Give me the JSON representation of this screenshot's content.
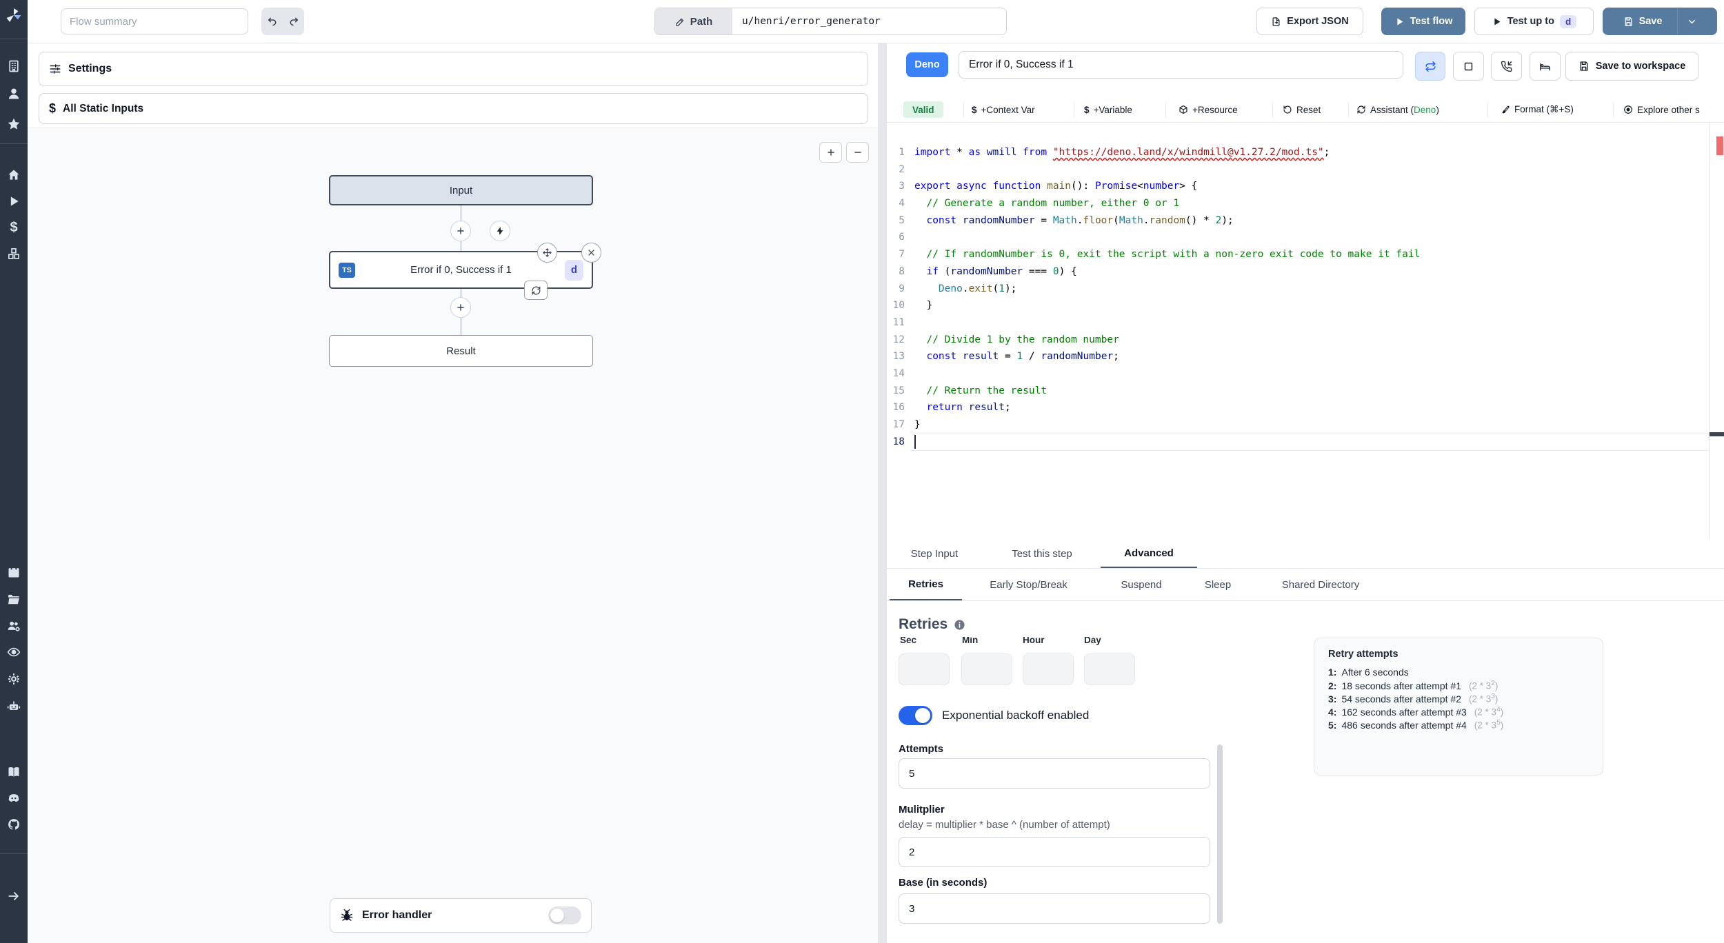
{
  "topbar": {
    "flow_summary_placeholder": "Flow summary",
    "path_label": "Path",
    "path_value": "u/henri/error_generator",
    "export_json_label": "Export JSON",
    "test_flow_label": "Test flow",
    "test_up_to_label": "Test up to",
    "test_up_to_step": "d",
    "save_label": "Save"
  },
  "flow_panel": {
    "settings_label": "Settings",
    "all_static_inputs_label": "All Static Inputs"
  },
  "canvas": {
    "input_node_label": "Input",
    "step_node_label": "Error if 0, Success if 1",
    "step_lang_badge": "TS",
    "step_id": "d",
    "result_node_label": "Result",
    "error_handler_label": "Error handler"
  },
  "editor": {
    "lang_badge": "Deno",
    "step_name": "Error if 0, Success if 1",
    "save_to_workspace_label": "Save to workspace",
    "toolbar": {
      "valid_label": "Valid",
      "context_var_label": "+Context Var",
      "variable_label": "+Variable",
      "resource_label": "+Resource",
      "reset_label": "Reset",
      "assistant_prefix": "Assistant (",
      "assistant_lang": "Deno",
      "assistant_suffix": ")",
      "format_label": "Format (⌘+S)",
      "explore_label": "Explore other s"
    },
    "active_line": 18,
    "code_lines": [
      [
        {
          "c": "kw",
          "t": "import"
        },
        {
          "c": "pl",
          "t": " * "
        },
        {
          "c": "kw",
          "t": "as"
        },
        {
          "c": "vr",
          "t": " wmill "
        },
        {
          "c": "kw",
          "t": "from"
        },
        {
          "c": "pl",
          "t": " "
        },
        {
          "c": "st sq",
          "t": "\"https://deno.land/x/windmill@v1.27.2/mod.ts\""
        },
        {
          "c": "pl",
          "t": ";"
        }
      ],
      [],
      [
        {
          "c": "kw",
          "t": "export"
        },
        {
          "c": "pl",
          "t": " "
        },
        {
          "c": "kw",
          "t": "async"
        },
        {
          "c": "pl",
          "t": " "
        },
        {
          "c": "kw",
          "t": "function"
        },
        {
          "c": "pl",
          "t": " "
        },
        {
          "c": "mt",
          "t": "main"
        },
        {
          "c": "pl",
          "t": "(): "
        },
        {
          "c": "kw",
          "t": "Promise"
        },
        {
          "c": "pl",
          "t": "<"
        },
        {
          "c": "kw",
          "t": "number"
        },
        {
          "c": "pl",
          "t": "> {"
        }
      ],
      [
        {
          "c": "cm",
          "t": "  // Generate a random number, either 0 or 1"
        }
      ],
      [
        {
          "c": "pl",
          "t": "  "
        },
        {
          "c": "kw",
          "t": "const"
        },
        {
          "c": "pl",
          "t": " "
        },
        {
          "c": "vr",
          "t": "randomNumber"
        },
        {
          "c": "pl",
          "t": " = "
        },
        {
          "c": "cl",
          "t": "Math"
        },
        {
          "c": "pl",
          "t": "."
        },
        {
          "c": "mt",
          "t": "floor"
        },
        {
          "c": "pl",
          "t": "("
        },
        {
          "c": "cl",
          "t": "Math"
        },
        {
          "c": "pl",
          "t": "."
        },
        {
          "c": "mt",
          "t": "random"
        },
        {
          "c": "pl",
          "t": "() * "
        },
        {
          "c": "nu",
          "t": "2"
        },
        {
          "c": "pl",
          "t": ");"
        }
      ],
      [],
      [
        {
          "c": "cm",
          "t": "  // If randomNumber is 0, exit the script with a non-zero exit code to make it fail"
        }
      ],
      [
        {
          "c": "pl",
          "t": "  "
        },
        {
          "c": "kw",
          "t": "if"
        },
        {
          "c": "pl",
          "t": " ("
        },
        {
          "c": "vr",
          "t": "randomNumber"
        },
        {
          "c": "pl",
          "t": " === "
        },
        {
          "c": "nu",
          "t": "0"
        },
        {
          "c": "pl",
          "t": ") {"
        }
      ],
      [
        {
          "c": "pl",
          "t": "    "
        },
        {
          "c": "cl",
          "t": "Deno"
        },
        {
          "c": "pl",
          "t": "."
        },
        {
          "c": "mt",
          "t": "exit"
        },
        {
          "c": "pl",
          "t": "("
        },
        {
          "c": "nu",
          "t": "1"
        },
        {
          "c": "pl",
          "t": ");"
        }
      ],
      [
        {
          "c": "pl",
          "t": "  }"
        }
      ],
      [],
      [
        {
          "c": "cm",
          "t": "  // Divide 1 by the random number"
        }
      ],
      [
        {
          "c": "pl",
          "t": "  "
        },
        {
          "c": "kw",
          "t": "const"
        },
        {
          "c": "pl",
          "t": " "
        },
        {
          "c": "vr",
          "t": "result"
        },
        {
          "c": "pl",
          "t": " = "
        },
        {
          "c": "nu",
          "t": "1"
        },
        {
          "c": "pl",
          "t": " / "
        },
        {
          "c": "vr",
          "t": "randomNumber"
        },
        {
          "c": "pl",
          "t": ";"
        }
      ],
      [],
      [
        {
          "c": "cm",
          "t": "  // Return the result"
        }
      ],
      [
        {
          "c": "pl",
          "t": "  "
        },
        {
          "c": "kw",
          "t": "return"
        },
        {
          "c": "pl",
          "t": " "
        },
        {
          "c": "vr",
          "t": "result"
        },
        {
          "c": "pl",
          "t": ";"
        }
      ],
      [
        {
          "c": "pl",
          "t": "}"
        }
      ],
      []
    ]
  },
  "step_tabs": [
    {
      "label": "Step Input"
    },
    {
      "label": "Test this step"
    },
    {
      "label": "Advanced"
    }
  ],
  "advanced_tabs": [
    {
      "label": "Retries"
    },
    {
      "label": "Early Stop/Break"
    },
    {
      "label": "Suspend"
    },
    {
      "label": "Sleep"
    },
    {
      "label": "Shared Directory"
    }
  ],
  "retries": {
    "heading": "Retries",
    "time_units": [
      "Sec",
      "Min",
      "Hour",
      "Day"
    ],
    "exponential_label": "Exponential backoff enabled",
    "attempts_label": "Attempts",
    "attempts_value": "5",
    "multiplier_label": "Mulitplier",
    "multiplier_help": "delay = multiplier * base ^ (number of attempt)",
    "multiplier_value": "2",
    "base_label": "Base (in seconds)",
    "base_value": "3",
    "retry_card": {
      "title": "Retry attempts",
      "items": [
        {
          "n": "1:",
          "text": "After 6 seconds",
          "formula": null,
          "sup": null
        },
        {
          "n": "2:",
          "text": "18 seconds after attempt #1",
          "formula": "(2 * 3",
          "sup": "2"
        },
        {
          "n": "3:",
          "text": "54 seconds after attempt #2",
          "formula": "(2 * 3",
          "sup": "3"
        },
        {
          "n": "4:",
          "text": "162 seconds after attempt #3",
          "formula": "(2 * 3",
          "sup": "4"
        },
        {
          "n": "5:",
          "text": "486 seconds after attempt #4",
          "formula": "(2 * 3",
          "sup": "5"
        }
      ]
    }
  },
  "colors": {
    "primary_button": "#567b9e",
    "deno_badge_blue": "#3b82f6",
    "valid_green": "#15803d",
    "toggle_on_blue": "#2563eb",
    "assistant_deno_green": "#16a34a",
    "sidebar_dark": "#2c3543"
  }
}
